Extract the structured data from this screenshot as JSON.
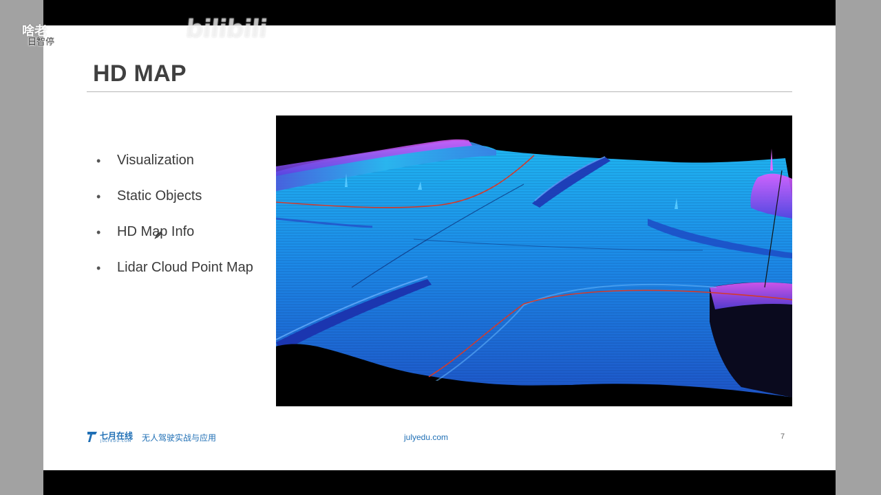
{
  "overlay": {
    "left_watermark_main": "啥老",
    "left_watermark_sub": "日智停",
    "bili_logo_text": "bilibili"
  },
  "slide": {
    "title": "HD MAP",
    "bullets": [
      {
        "text": "Visualization"
      },
      {
        "text": "Static Objects"
      },
      {
        "text": "HD Map Info"
      },
      {
        "text": "Lidar Cloud Point Map"
      }
    ],
    "bullet_glyph": "•",
    "image_icon": "lidar-point-cloud-image",
    "footer": {
      "logo_name": "七月在线",
      "logo_domain": "JULYEDU.COM",
      "course_name": "无人驾驶实战与应用",
      "url": "julyedu.com",
      "page_number": "7"
    }
  },
  "colors": {
    "video_letterbox": "#000000",
    "window_background": "#a2a2a2",
    "slide_background": "#ffffff",
    "title_text": "#404040",
    "brand_blue": "#1f6fb5",
    "lidar_road": "#1e7ee6",
    "lidar_edges": "#c23cff",
    "trajectory": "#d43a2a"
  }
}
